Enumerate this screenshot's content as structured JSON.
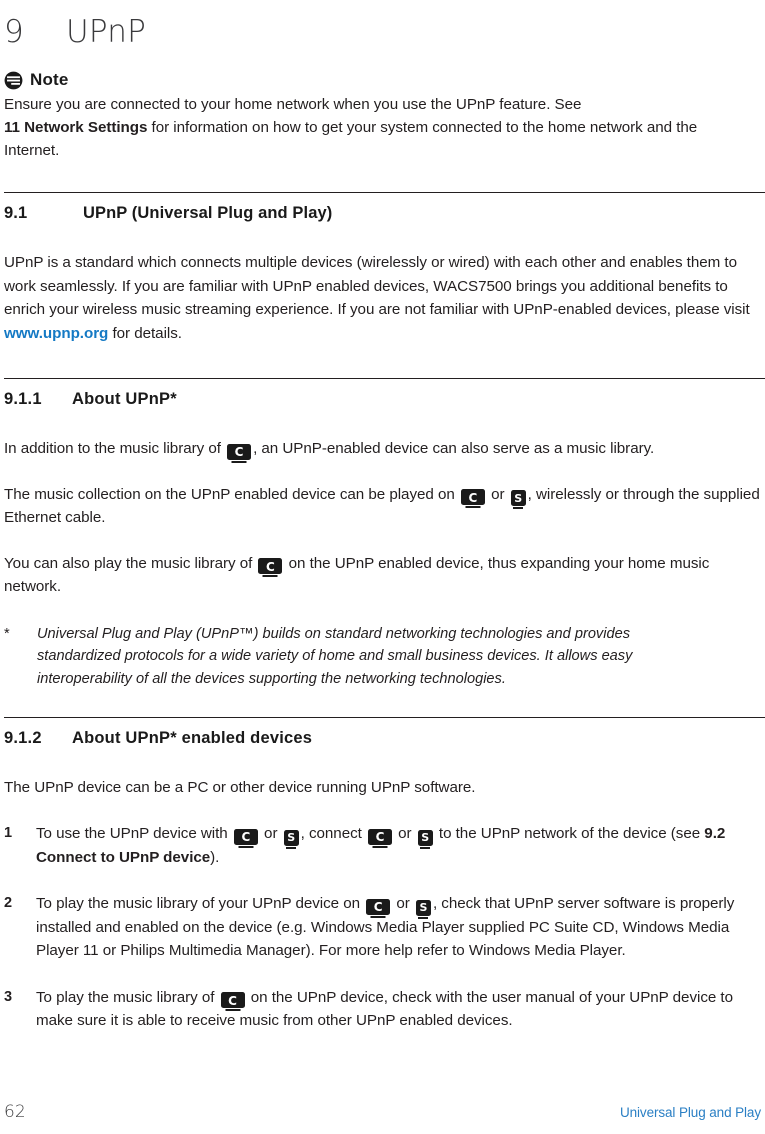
{
  "chapter": {
    "number": "9",
    "title": "UPnP"
  },
  "note": {
    "icon": "note-icon",
    "label": "Note",
    "line1": "Ensure you are connected to your home network when you use the UPnP feature. See",
    "bold1": "11 Network Settings",
    "line2": " for information on how to get your system connected to the home network and the Internet."
  },
  "sections": {
    "s91": {
      "number": "9.1",
      "title": "UPnP (Universal Plug and Play)",
      "para1_a": "UPnP is a standard which connects multiple devices (wirelessly or wired) with each other and enables them to work seamlessly. If you are familiar with UPnP enabled devices, WACS7500 brings you additional benefits to enrich your wireless music streaming experience. If you are not familiar with UPnP-enabled devices, please visit ",
      "link_text": "www.upnp.org",
      "para1_b": " for details."
    },
    "s911": {
      "number": "9.1.1",
      "title": "About UPnP*",
      "p1_a": "In addition to the music library of ",
      "p1_b": ", an UPnP-enabled device can also serve as a music library.",
      "p2_a": "The music collection on the UPnP enabled device can be played on ",
      "p2_mid": " or ",
      "p2_b": ", wirelessly or through the supplied Ethernet cable.",
      "p3_a": "You can also play the music library of ",
      "p3_b": " on the UPnP enabled device, thus expanding your home music network.",
      "footnote_mark": "*",
      "footnote_text": "Universal Plug and Play (UPnP™) builds on standard networking technologies and provides standardized protocols for a wide variety of home and small business devices. It allows easy interoperability of all the devices supporting the networking technologies."
    },
    "s912": {
      "number": "9.1.2",
      "title": "About UPnP* enabled devices",
      "intro": "The UPnP device can be a PC or other device running UPnP software.",
      "steps": [
        {
          "n": "1",
          "a": "To use the UPnP device with ",
          "b": " or ",
          "c": ", connect ",
          "d": " or ",
          "e": " to the UPnP network of the device (see ",
          "bold": "9.2 Connect to UPnP device",
          "f": ")."
        },
        {
          "n": "2",
          "a": "To play the music library of your UPnP device on ",
          "b": " or ",
          "c": ", check that UPnP server software is properly installed and enabled on the device (e.g. Windows Media Player supplied PC Suite CD, Windows Media Player 11 or Philips Multimedia Manager). For more help refer to Windows Media Player."
        },
        {
          "n": "3",
          "a": "To play the music library of ",
          "b": " on the UPnP device, check with the user manual of your UPnP device to make sure it is able to receive music from other UPnP enabled devices."
        }
      ]
    }
  },
  "device_icons": {
    "center": "C",
    "station": "S"
  },
  "footer": {
    "page_number": "62",
    "chapter_name": "Universal Plug and Play"
  },
  "colors": {
    "link": "#1479c4",
    "footer_link": "#2a7fc4",
    "text": "#231f20",
    "rule": "#231f20"
  }
}
